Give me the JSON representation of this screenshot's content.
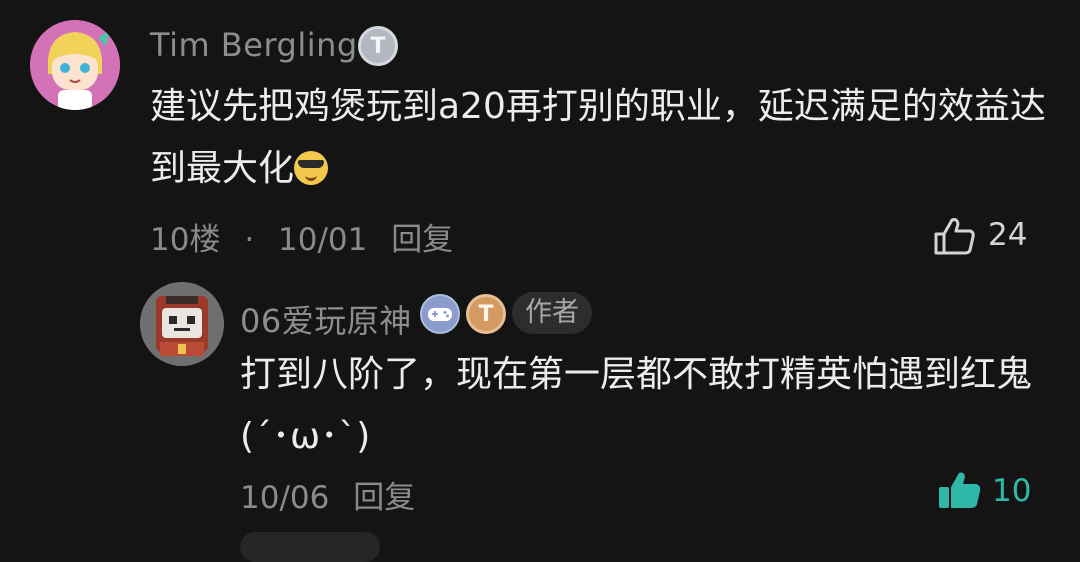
{
  "comment": {
    "username": "Tim Bergling",
    "level_badge": "T",
    "content": "建议先把鸡煲玩到a20再打别的职业，延迟满足的效益达到最大化",
    "floor": "10楼",
    "separator": "·",
    "date": "10/01",
    "reply_label": "回复",
    "likes": "24"
  },
  "reply": {
    "username": "06爱玩原神",
    "level_badge": "T",
    "author_tag": "作者",
    "content": "打到八阶了，现在第一层都不敢打精英怕遇到红鬼(´･ω･`)",
    "date": "10/06",
    "reply_label": "回复",
    "likes": "10"
  },
  "colors": {
    "background": "#141414",
    "muted_text": "#8a8a8a",
    "liked_accent": "#2fb8a8",
    "badge_silver": "#b3b7bf",
    "badge_bronze": "#d49a62"
  }
}
